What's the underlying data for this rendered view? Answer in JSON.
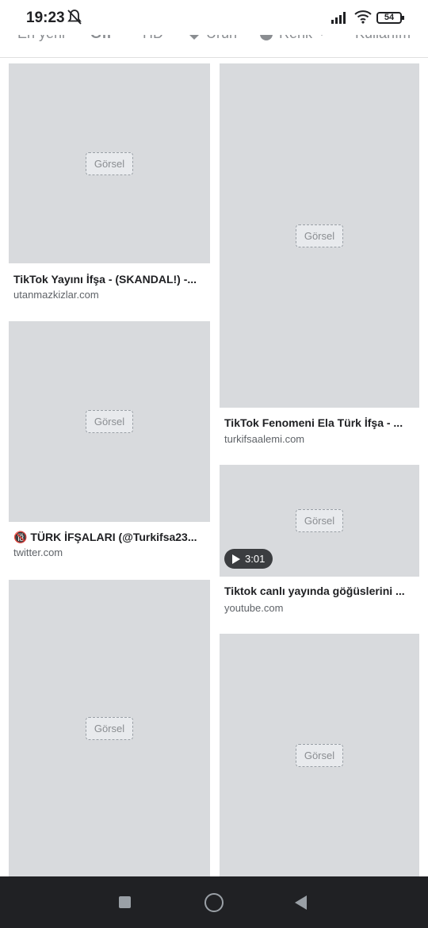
{
  "status_bar": {
    "time": "19:23",
    "battery": "54"
  },
  "filters": [
    "En yeni",
    "GIF",
    "HD",
    "Ürün",
    "Renk",
    "Kullanım"
  ],
  "placeholder_text": "Görsel",
  "left_column": [
    {
      "caption": "TikTok Yayını İfşa - (SKANDAL!) -...",
      "source": "utanmazkizlar.com"
    },
    {
      "caption": "🔞 TÜRK İFŞALARI (@Turkifsa23...",
      "source": "twitter.com"
    },
    {
      "caption": "",
      "source": ""
    }
  ],
  "right_column": [
    {
      "caption": "TikTok Fenomeni Ela Türk İfşa - ...",
      "source": "turkifsaalemi.com"
    },
    {
      "caption": "Tiktok canlı yayında göğüslerini ...",
      "source": "youtube.com",
      "duration": "3:01"
    },
    {
      "caption": "",
      "source": ""
    }
  ]
}
